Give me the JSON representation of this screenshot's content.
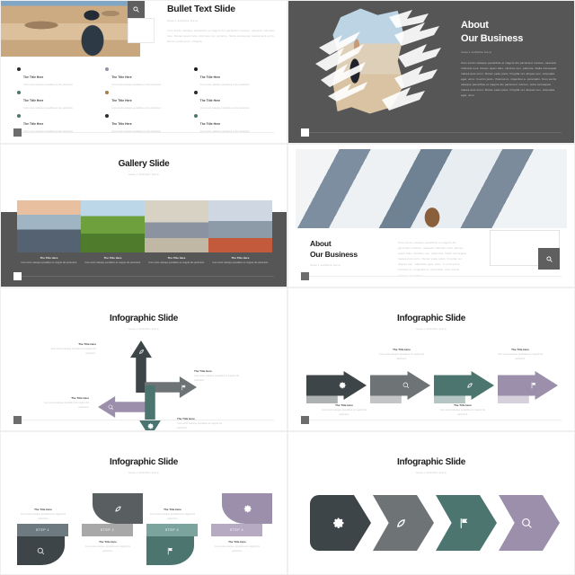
{
  "palette": {
    "dark": "#3d4548",
    "gray": "#6e7376",
    "teal": "#4d7570",
    "purple": "#9b8fab",
    "slide_bg_dark": "#565656",
    "title_color": "#1c1c1c",
    "muted": "#c2c2c2"
  },
  "common": {
    "subtitle": "insert subtitle here",
    "item_title": "The Title Here",
    "body_short": "Curs socis natoque penatibus et",
    "body_short2": "magnis dis parturient.",
    "bullet_desc": "Curs socis natoque penatibus et dis parturient"
  },
  "slides": [
    {
      "id": "bullet-text-slide",
      "title": "Bullet Text Slide",
      "subtitle": "insert subtitle here",
      "body": "Cum sociis natoque penatibus et magnis dis parturient montes, nascetur ridiculus mus. Donec quam felis, ultricies nec, pellente. Nulla consequat massa quis enim. Donec pede justo, fringilla.",
      "search_icon": "search-icon",
      "bullets": [
        {
          "title": "The Title Here",
          "desc": "Curs socis natoque penatibus et dis parturient",
          "color": "#2b2b2b"
        },
        {
          "title": "The Title Here",
          "desc": "Curs socis natoque penatibus et dis parturient",
          "color": "#9b8fab"
        },
        {
          "title": "The Title Here",
          "desc": "Curs socis natoque penatibus et dis parturient",
          "color": "#1c1c1c"
        },
        {
          "title": "The Title Here",
          "desc": "Curs socis natoque penatibus et dis parturient",
          "color": "#4d7570"
        },
        {
          "title": "The Title Here",
          "desc": "Curs socis natoque penatibus et dis parturient",
          "color": "#a87c4f"
        },
        {
          "title": "The Title Here",
          "desc": "Curs socis natoque penatibus et dis parturient",
          "color": "#2b2b2b"
        },
        {
          "title": "The Title Here",
          "desc": "Curs socis natoque penatibus et dis parturient",
          "color": "#4d7570"
        },
        {
          "title": "The Title Here",
          "desc": "Curs socis natoque penatibus et dis parturient",
          "color": "#2b2b2b"
        },
        {
          "title": "The Title Here",
          "desc": "Curs socis natoque penatibus et dis parturient",
          "color": "#4d7570"
        }
      ]
    },
    {
      "id": "about-our-business-dark",
      "title_line1": "About",
      "title_line2": "Our Business",
      "subtitle": "insert subtitle here",
      "body": "Cum sociis natoque penatibus et magnis dis parturient montes, nascetur ridiculus mus. Donec quam felis, ultricies nec, pellente. Nulla consequat massa quis enim. Donec pede justo, fringilla vel, aliquet nec, vulputate eget, arcu. In enim justo, rhoncus ut, imperdiet a, venenatis. Cum sociis natoque penatibus et magnis dis parturient montes, nulla consequat massa quis enim. Donec pede justo, fringilla vel, aliquet nec, vulputate eget, arcu."
    },
    {
      "id": "gallery-slide",
      "title": "Gallery Slide",
      "subtitle": "insert subtitle here",
      "captions": [
        {
          "title": "The Title Here",
          "desc": "Curs socis natoque penatibus et magnis dis parturient."
        },
        {
          "title": "The Title Here",
          "desc": "Curs socis natoque penatibus et magnis dis parturient."
        },
        {
          "title": "The Title Here",
          "desc": "Curs socis natoque penatibus et magnis dis parturient."
        },
        {
          "title": "The Title Here",
          "desc": "Curs socis natoque penatibus et magnis dis parturient."
        }
      ]
    },
    {
      "id": "about-our-business-photo",
      "title_line1": "About",
      "title_line2": "Our Business",
      "subtitle": "insert subtitle here",
      "body": "Cum sociis natoque penatibus et magnis dis parturient montes, nascetur ridiculus mus. Donec quam felis, ultricies nec, pellentes. Nulla consequat massa quis enim. Donec pede justo, fringilla vel, aliquet nec, vulputate eget, arcu. In enim justo, rhoncus ut, imperdiet a, venenatis. Cum sociis natoque penatibus.",
      "search_icon": "search-icon"
    },
    {
      "id": "infographic-cross-arrows",
      "title": "Infographic Slide",
      "subtitle": "insert subtitle here",
      "arrows": [
        {
          "dir": "up",
          "icon": "leaf-icon",
          "color": "#3d4548"
        },
        {
          "dir": "right",
          "icon": "flag-icon",
          "color": "#6e7376"
        },
        {
          "dir": "left",
          "icon": "search-icon",
          "color": "#9b8fab"
        },
        {
          "dir": "down",
          "icon": "gear-icon",
          "color": "#4d7570"
        }
      ],
      "labels": [
        {
          "title": "The Title Here",
          "desc": "Curs socis natoque penatibus et magnis dis parturient."
        },
        {
          "title": "The Title Here",
          "desc": "Curs socis natoque penatibus et magnis dis parturient."
        },
        {
          "title": "The Title Here",
          "desc": "Curs socis natoque penatibus et magnis dis parturient."
        },
        {
          "title": "The Title Here",
          "desc": "Curs socis natoque penatibus et magnis dis parturient."
        }
      ]
    },
    {
      "id": "infographic-row-arrows",
      "title": "Infographic Slide",
      "subtitle": "insert subtitle here",
      "arrows": [
        {
          "icon": "gear-icon",
          "color": "#3d4548",
          "title": "The Title Here",
          "desc": "Curs socis natoque penatibus et magnis dis parturient."
        },
        {
          "icon": "search-icon",
          "color": "#6e7376",
          "title": "The Title Here",
          "desc": "Curs socis natoque penatibus et magnis dis parturient."
        },
        {
          "icon": "leaf-icon",
          "color": "#4d7570",
          "title": "The Title Here",
          "desc": "Curs socis natoque penatibus et magnis dis parturient."
        },
        {
          "icon": "flag-icon",
          "color": "#9b8fab",
          "title": "The Title Here",
          "desc": "Curs socis natoque penatibus et magnis dis parturient."
        }
      ]
    },
    {
      "id": "infographic-steps",
      "title": "Infographic Slide",
      "subtitle": "insert subtitle here",
      "steps": [
        {
          "label": "STEP 1",
          "icon_top": "",
          "icon_bottom": "search-icon",
          "color": "#3d4548",
          "bar_color": "#6d7a80",
          "title": "The Title Here",
          "desc": "Curs socis natoque penatibus et magnis dis parturient."
        },
        {
          "label": "STEP 2",
          "icon_top": "leaf-icon",
          "icon_bottom": "",
          "color": "#6e7376",
          "bar_color": "#a8a8a8",
          "title": "The Title Here",
          "desc": "Curs socis natoque penatibus et magnis dis parturient."
        },
        {
          "label": "STEP 3",
          "icon_top": "",
          "icon_bottom": "flag-icon",
          "color": "#4d7570",
          "bar_color": "#7ba49e",
          "title": "The Title Here",
          "desc": "Curs socis natoque penatibus et magnis dis parturient."
        },
        {
          "label": "STEP 4",
          "icon_top": "gear-icon",
          "icon_bottom": "",
          "color": "#9b8fab",
          "bar_color": "#b6aac2",
          "title": "The Title Here",
          "desc": "Curs socis natoque penatibus et magnis dis parturient."
        }
      ]
    },
    {
      "id": "infographic-chevrons",
      "title": "Infographic Slide",
      "subtitle": "insert subtitle here",
      "chevrons": [
        {
          "icon": "gear-icon",
          "color": "#3d4548"
        },
        {
          "icon": "leaf-icon",
          "color": "#6e7376"
        },
        {
          "icon": "flag-icon",
          "color": "#4d7570"
        },
        {
          "icon": "search-icon",
          "color": "#9b8fab"
        }
      ]
    }
  ]
}
